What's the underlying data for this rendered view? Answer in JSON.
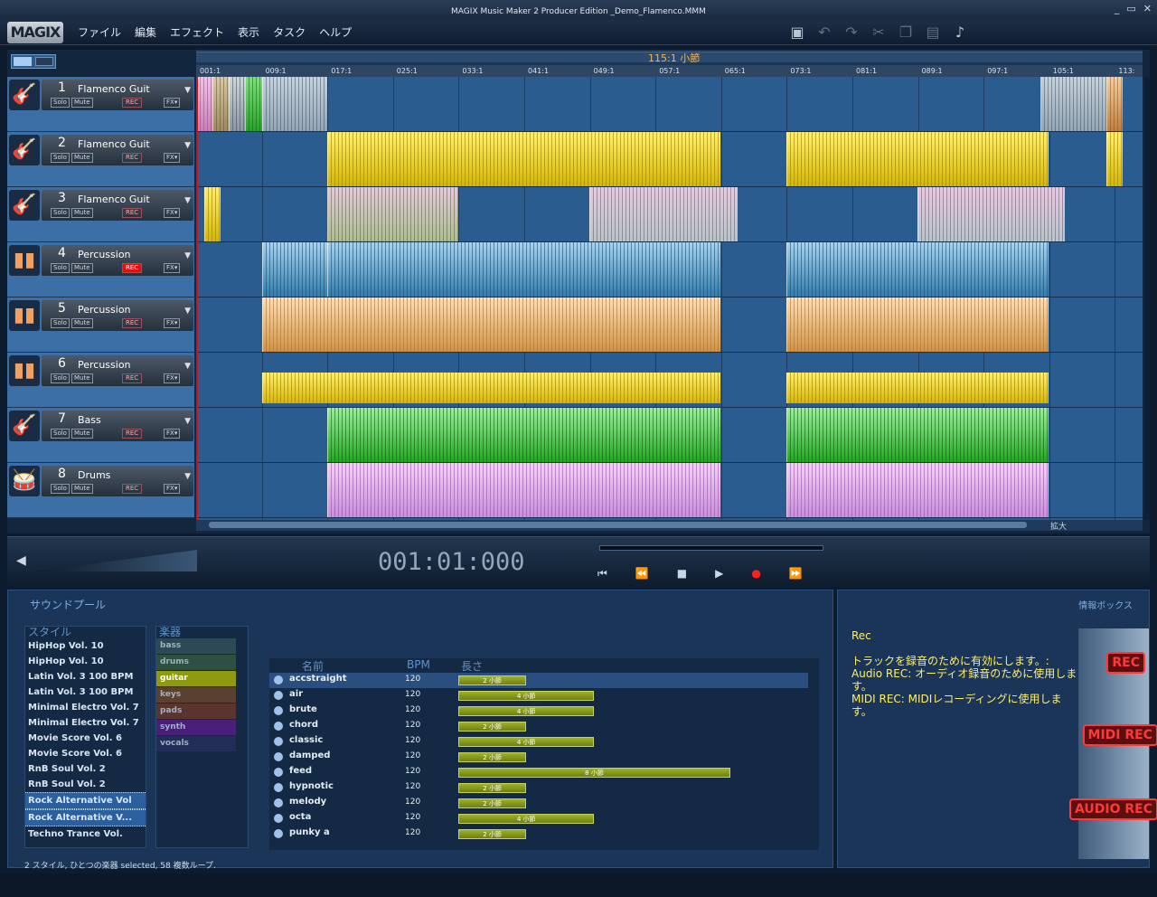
{
  "window": {
    "title": "MAGIX Music Maker 2 Producer Edition    _Demo_Flamenco.MMM",
    "controls": [
      "_",
      "▭",
      "✕"
    ]
  },
  "menubar": {
    "logo": "MAGIX",
    "menus": [
      "ファイル",
      "編集",
      "エフェクト",
      "表示",
      "タスク",
      "ヘルプ"
    ]
  },
  "toolbar": {
    "icons": [
      "save-icon",
      "undo-icon",
      "redo-icon",
      "cut-icon",
      "copy-icon",
      "paste-icon",
      "note-icon"
    ]
  },
  "ruler": {
    "range_label": "115:1 小節",
    "ticks": [
      "001:1",
      "009:1",
      "017:1",
      "025:1",
      "033:1",
      "041:1",
      "049:1",
      "057:1",
      "065:1",
      "073:1",
      "081:1",
      "089:1",
      "097:1",
      "105:1",
      "113:"
    ]
  },
  "tracks": [
    {
      "num": "1",
      "name": "Flamenco Guit",
      "icon": "guitar-icon",
      "rec_active": false
    },
    {
      "num": "2",
      "name": "Flamenco Guit",
      "icon": "guitar-icon",
      "rec_active": false
    },
    {
      "num": "3",
      "name": "Flamenco Guit",
      "icon": "guitar-icon",
      "rec_active": false
    },
    {
      "num": "4",
      "name": "Percussion",
      "icon": "conga-icon",
      "rec_active": true
    },
    {
      "num": "5",
      "name": "Percussion",
      "icon": "conga-icon",
      "rec_active": false
    },
    {
      "num": "6",
      "name": "Percussion",
      "icon": "conga-icon",
      "rec_active": false
    },
    {
      "num": "7",
      "name": "Bass",
      "icon": "bass-icon",
      "rec_active": false
    },
    {
      "num": "8",
      "name": "Drums",
      "icon": "drum-icon",
      "rec_active": false
    }
  ],
  "track_buttons": {
    "solo": "Solo",
    "mute": "Mute",
    "rec": "REC",
    "fx": "FX"
  },
  "scroll": {
    "zoom_label": "拡大"
  },
  "transport": {
    "timecode": "001:01:000"
  },
  "soundpool": {
    "title": "サウンドプール",
    "style_header": "スタイル",
    "styles": [
      "HipHop Vol. 10",
      "HipHop Vol. 10",
      "Latin Vol. 3 100 BPM",
      "Latin Vol. 3 100 BPM",
      "Minimal Electro Vol. 7",
      "Minimal Electro Vol. 7",
      "Movie Score Vol. 6",
      "Movie Score Vol. 6",
      "RnB Soul Vol. 2",
      "RnB Soul Vol. 2",
      "Rock Alternative Vol",
      "Rock Alternative V...",
      "Techno Trance Vol."
    ],
    "selected_styles": [
      10,
      11
    ],
    "instrument_header": "楽器",
    "instruments": [
      {
        "name": "bass",
        "color": "#2d4a54"
      },
      {
        "name": "drums",
        "color": "#2f4f40"
      },
      {
        "name": "guitar",
        "color": "#8e9a10"
      },
      {
        "name": "keys",
        "color": "#5a4030"
      },
      {
        "name": "pads",
        "color": "#5a3530"
      },
      {
        "name": "synth",
        "color": "#48207a"
      },
      {
        "name": "vocals",
        "color": "#222e56"
      }
    ],
    "selected_instrument": 2,
    "loop_headers": {
      "name": "名前",
      "bpm": "BPM",
      "length": "長さ"
    },
    "loops": [
      {
        "name": "accstraight",
        "bpm": "120",
        "bars": 2,
        "length": "2 小節"
      },
      {
        "name": "air",
        "bpm": "120",
        "bars": 4,
        "length": "4 小節"
      },
      {
        "name": "brute",
        "bpm": "120",
        "bars": 4,
        "length": "4 小節"
      },
      {
        "name": "chord",
        "bpm": "120",
        "bars": 2,
        "length": "2 小節"
      },
      {
        "name": "classic",
        "bpm": "120",
        "bars": 4,
        "length": "4 小節"
      },
      {
        "name": "damped",
        "bpm": "120",
        "bars": 2,
        "length": "2 小節"
      },
      {
        "name": "feed",
        "bpm": "120",
        "bars": 8,
        "length": "8 小節"
      },
      {
        "name": "hypnotic",
        "bpm": "120",
        "bars": 2,
        "length": "2 小節"
      },
      {
        "name": "melody",
        "bpm": "120",
        "bars": 2,
        "length": "2 小節"
      },
      {
        "name": "octa",
        "bpm": "120",
        "bars": 4,
        "length": "4 小節"
      },
      {
        "name": "punky a",
        "bpm": "120",
        "bars": 2,
        "length": "2 小節"
      }
    ],
    "status": "2 スタイル, ひとつの楽器 selected, 58 複数ループ."
  },
  "infobox": {
    "title": "情報ボックス",
    "heading": "Rec",
    "lines": [
      "トラックを録音のために有効にします。:",
      "Audio REC: オーディオ録音のために使用します。",
      "MIDI REC: MIDIレコーディングに使用します。"
    ],
    "badges": [
      "REC",
      "MIDI REC",
      "AUDIO REC"
    ]
  }
}
